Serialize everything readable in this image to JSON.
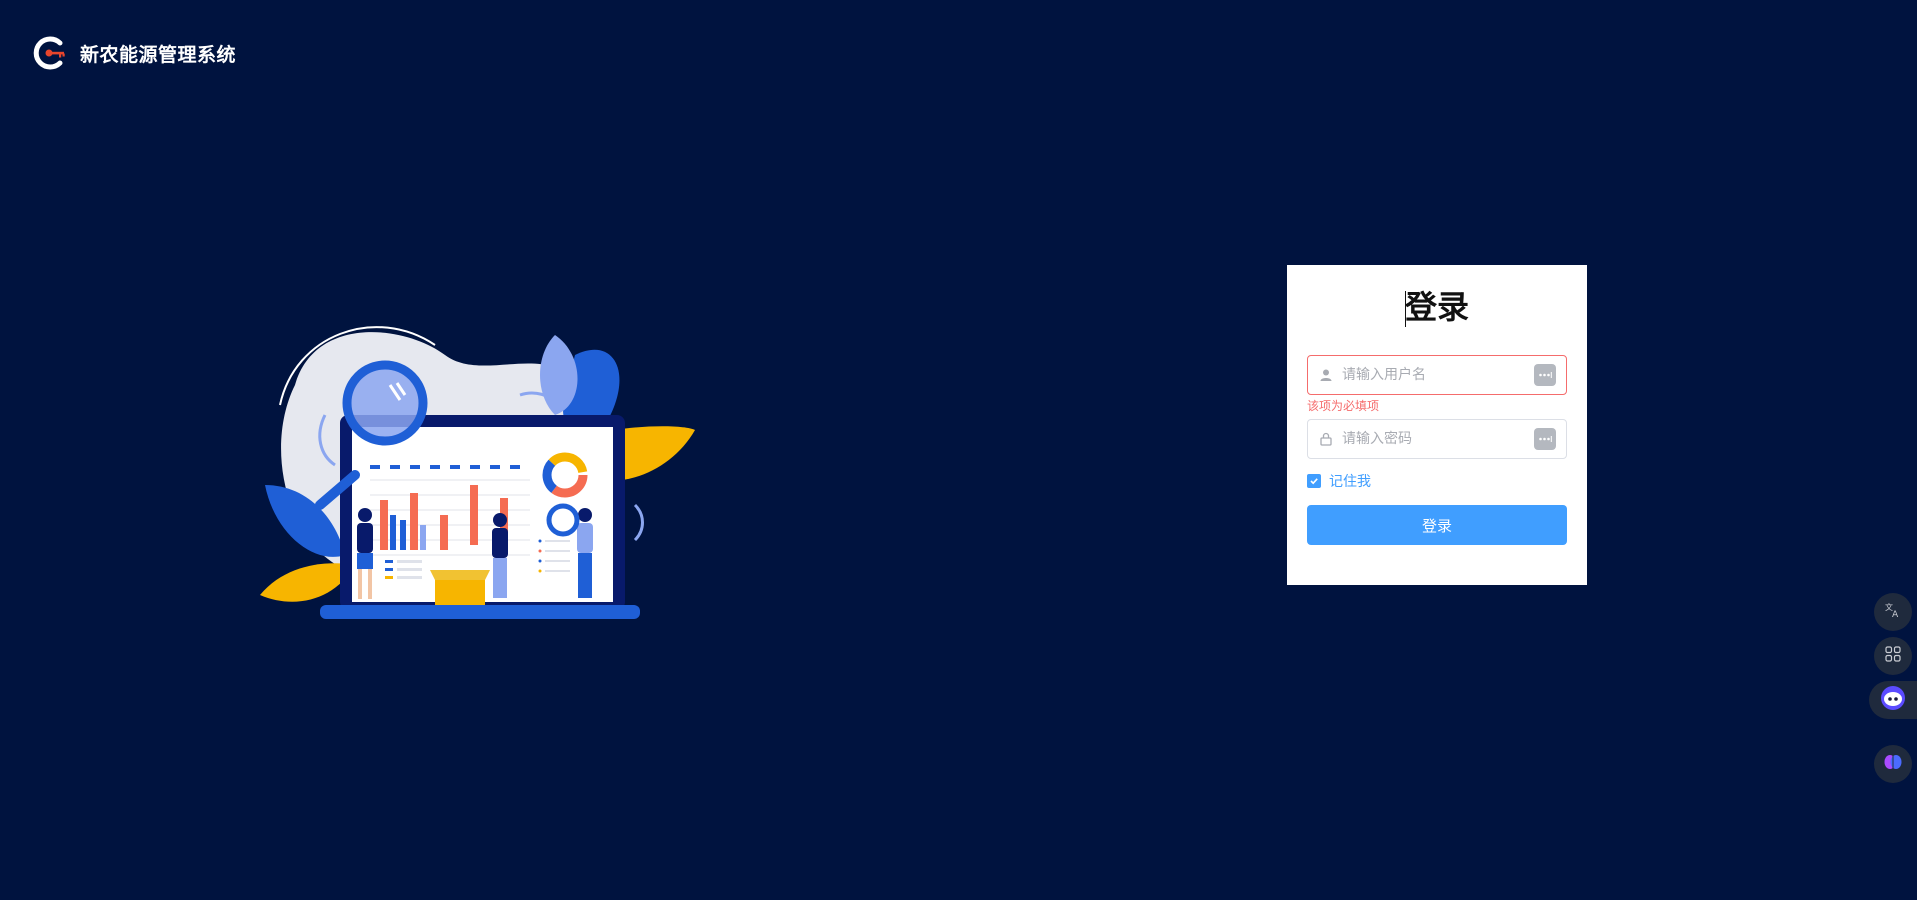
{
  "app": {
    "title": "新农能源管理系统"
  },
  "login": {
    "heading": "登录",
    "username_placeholder": "请输入用户名",
    "username_value": "",
    "username_error": "该项为必填项",
    "password_placeholder": "请输入密码",
    "password_value": "",
    "remember_label": "记住我",
    "remember_checked": true,
    "submit_label": "登录"
  },
  "floating_tools": [
    {
      "icon": "translate-icon"
    },
    {
      "icon": "apps-grid-icon"
    },
    {
      "icon": "ai-assistant-icon"
    },
    {
      "icon": "brain-icon"
    }
  ],
  "colors": {
    "background": "#00133f",
    "primary": "#409eff",
    "error": "#f56c6c",
    "logo_accent": "#e8452c"
  }
}
